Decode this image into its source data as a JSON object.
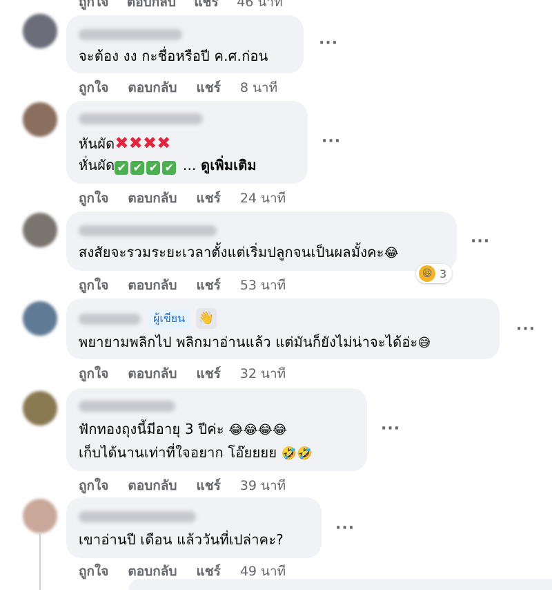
{
  "comments": [
    {
      "text_lines": [
        "จะต้อง งง กะชื่อหรือปี ค.ศ.ก่อน"
      ],
      "actions": {
        "like": "ถูกใจ",
        "reply": "ตอบกลับ",
        "share": "แชร์",
        "time": "8 นาที"
      }
    },
    {
      "text_lines": [
        "หันผัด",
        "หั่นผัด"
      ],
      "see_more": "ดูเพิ่มเติม",
      "actions": {
        "like": "ถูกใจ",
        "reply": "ตอบกลับ",
        "share": "แชร์",
        "time": "24 นาที"
      }
    },
    {
      "text_lines": [
        "สงสัยจะรวมระยะเวลาตั้งแต่เริ่มปลูกจนเป็นผลมั้งคะ"
      ],
      "reaction_count": "3",
      "actions": {
        "like": "ถูกใจ",
        "reply": "ตอบกลับ",
        "share": "แชร์",
        "time": "53 นาที"
      }
    },
    {
      "author_badge": "ผู้เขียน",
      "text_lines": [
        "พยายามพลิกไป พลิกมาอ่านแล้ว แต่มันก็ยังไม่น่าจะได้อ่ะ"
      ],
      "actions": {
        "like": "ถูกใจ",
        "reply": "ตอบกลับ",
        "share": "แชร์",
        "time": "32 นาที"
      }
    },
    {
      "text_lines": [
        "ฟักทองถุงนี้มีอายุ 3 ปีค่ะ",
        "เก็บได้นานเท่าที่ใจอยาก โอ๊ยยยย"
      ],
      "actions": {
        "like": "ถูกใจ",
        "reply": "ตอบกลับ",
        "share": "แชร์",
        "time": "39 นาที"
      }
    },
    {
      "text_lines": [
        "เขาอ่านปี เดือน แล้ววันที่เปล่าคะ?"
      ],
      "actions": {
        "like": "ถูกใจ",
        "reply": "ตอบกลับ",
        "share": "แชร์",
        "time": "49 นาที"
      }
    }
  ],
  "top_partial_actions": {
    "like": "ถูกใจ",
    "reply": "ตอบกลับ",
    "share": "แชร์",
    "time": "46 นาที"
  },
  "more_icon": "ellipsis-icon",
  "colors": {
    "bubble": "#f0f2f5",
    "secondary_text": "#65676b",
    "author_tag": "#1877f2"
  }
}
